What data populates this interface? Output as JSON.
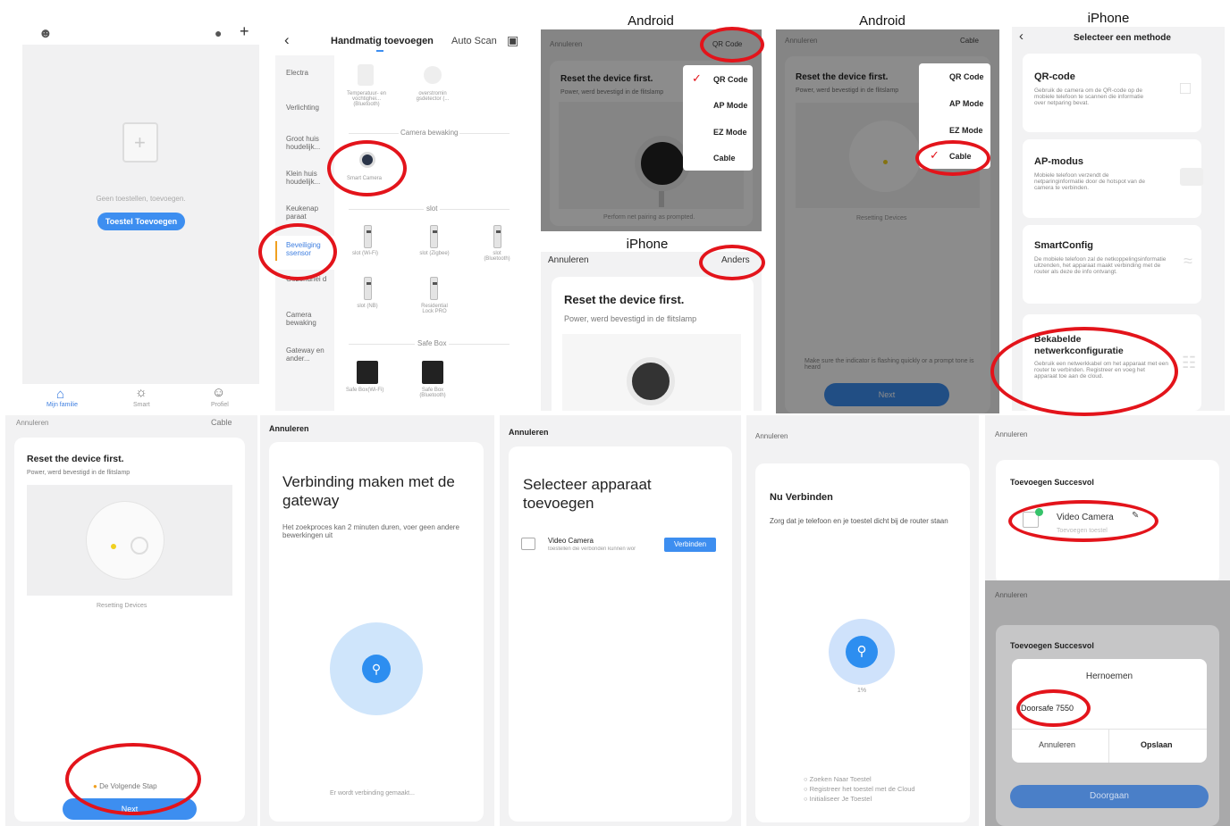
{
  "labels": {
    "android1": "Android",
    "android2": "Android",
    "iphone1": "iPhone",
    "iphone2": "iPhone"
  },
  "home": {
    "empty_text": "Geen toestellen, toevoegen.",
    "add_button": "Toestel Toevoegen",
    "nav": [
      "Mijn familie",
      "Smart",
      "Profiel"
    ]
  },
  "add": {
    "title": "Handmatig toevoegen",
    "autoscan": "Auto Scan",
    "categories": [
      "Electra",
      "Verlichting",
      "Groot huis houdelijk...",
      "Klein huis houdelijk...",
      "Keukenap paraat",
      "Beveiliging ssensor",
      "Gezondhei d",
      "Camera bewaking",
      "Gateway en ander..."
    ],
    "top_devices": [
      "Temperatuur- en vochtighei... (Bluetooth)",
      "overstromin gsdetector (..."
    ],
    "section_camera": "Camera bewaking",
    "camera_device": "Smart Camera",
    "section_slot": "slot",
    "slot_devices": [
      "slot (Wi-Fi)",
      "slot (Zigbee)",
      "slot (Bluetooth)",
      "slot (NB)",
      "Residential Lock PRO"
    ],
    "section_safebox": "Safe Box",
    "safebox_devices": [
      "Safe Box(Wi-Fi)",
      "Safe Box (Bluetooth)"
    ]
  },
  "a1": {
    "cancel": "Annuleren",
    "mode": "QR Code",
    "title": "Reset the device first.",
    "sub": "Power, werd bevestigd in de flitslamp",
    "menu": [
      "QR Code",
      "AP Mode",
      "EZ Mode",
      "Cable"
    ],
    "footer": "Perform net pairing as prompted."
  },
  "a2": {
    "cancel": "Annuleren",
    "mode": "Cable",
    "title": "Reset the device first.",
    "sub": "Power, werd bevestigd in de flitslamp",
    "menu": [
      "QR Code",
      "AP Mode",
      "EZ Mode",
      "Cable"
    ],
    "resetting": "Resetting Devices",
    "check": "Make sure the indicator is flashing quickly or a prompt tone is heard",
    "next": "Next"
  },
  "i1": {
    "cancel": "Annuleren",
    "other": "Anders",
    "title": "Reset the device first.",
    "sub": "Power, werd bevestigd in de flitslamp"
  },
  "i2": {
    "title": "Selecteer een methode",
    "methods": [
      {
        "name": "QR-code",
        "desc": "Gebruik de camera om de QR-code op de mobiele telefoon te scannen die informatie over netparing bevat."
      },
      {
        "name": "AP-modus",
        "desc": "Mobiele telefoon verzendt de netparinginformatie door de hotspot van de camera te verbinden."
      },
      {
        "name": "SmartConfig",
        "desc": "De mobiele telefoon zal de netkoppelingsinformatie uitzenden, het apparaat maakt verbinding met de router als deze de info ontvangt."
      },
      {
        "name": "Bekabelde netwerkconfiguratie",
        "desc": "Gebruik een netwerkkabel om het apparaat met een router te verbinden. Registreer en voeg het apparaat toe aan de cloud."
      }
    ]
  },
  "b1": {
    "cancel": "Annuleren",
    "mode": "Cable",
    "title": "Reset the device first.",
    "sub": "Power, werd bevestigd in de flitslamp",
    "resetting": "Resetting Devices",
    "check": "De Volgende Stap",
    "next": "Next"
  },
  "b2": {
    "cancel": "Annuleren",
    "title": "Verbinding maken met de gateway",
    "sub": "Het zoekproces kan 2 minuten duren, voer geen andere bewerkingen uit",
    "footer": "Er wordt verbinding gemaakt..."
  },
  "b3": {
    "cancel": "Annuleren",
    "title": "Selecteer apparaat toevoegen",
    "device": "Video Camera",
    "device_sub": "toestellen die verbonden kunnen wor",
    "connect": "Verbinden"
  },
  "b4": {
    "cancel": "Annuleren",
    "title": "Nu Verbinden",
    "sub": "Zorg dat je telefoon en je toestel dicht bij de router staan",
    "percent": "1%",
    "steps": [
      "Zoeken Naar Toestel",
      "Registreer het toestel met de Cloud",
      "Initialiseer Je Toestel"
    ]
  },
  "b5": {
    "cancel": "Annuleren",
    "title": "Toevoegen Succesvol",
    "device": "Video Camera",
    "device_sub": "Toevoegen toestel"
  },
  "b6": {
    "cancel": "Annuleren",
    "title": "Toevoegen Succesvol",
    "dialog_title": "Hernoemen",
    "name_value": "Doorsafe 7550",
    "cancel_btn": "Annuleren",
    "save_btn": "Opslaan",
    "done": "Doorgaan"
  }
}
